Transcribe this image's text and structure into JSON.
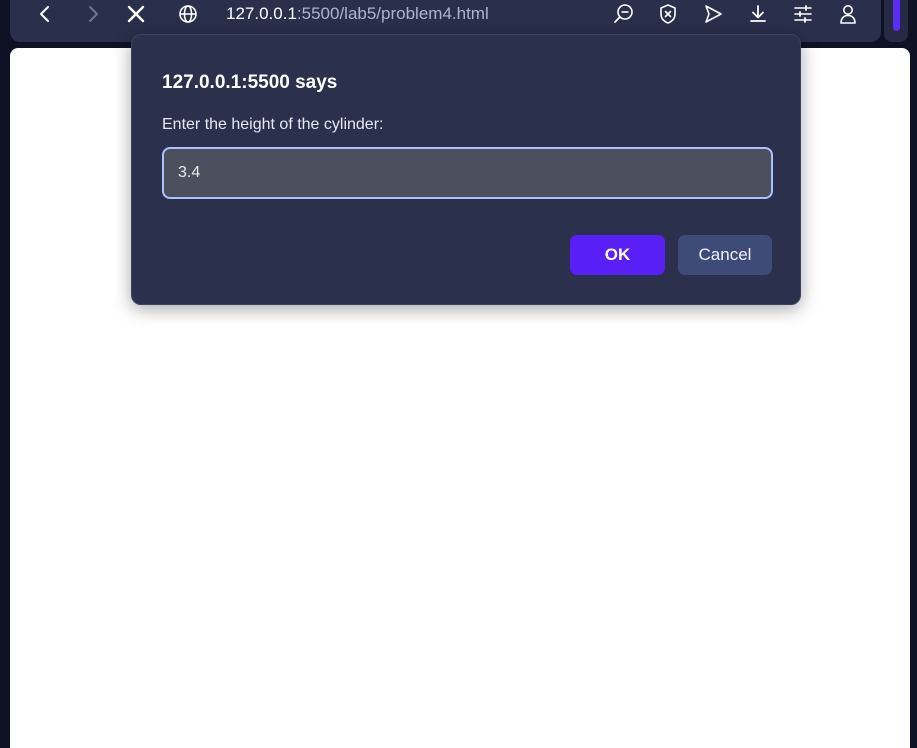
{
  "browser": {
    "url_host": "127.0.0.1",
    "url_rest": ":5500/lab5/problem4.html",
    "icons": [
      "back-icon",
      "forward-icon",
      "stop-loading-icon",
      "site-info-globe-icon",
      "zoom-out-icon",
      "shield-icon",
      "send-icon",
      "download-icon",
      "easy-setup-icon",
      "profile-icon"
    ],
    "accent_color": "#5a2cf5"
  },
  "dialog": {
    "title": "127.0.0.1:5500 says",
    "message": "Enter the height of the cylinder:",
    "input_value": "3.4",
    "ok_label": "OK",
    "cancel_label": "Cancel",
    "ok_color": "#5a1ff6"
  }
}
